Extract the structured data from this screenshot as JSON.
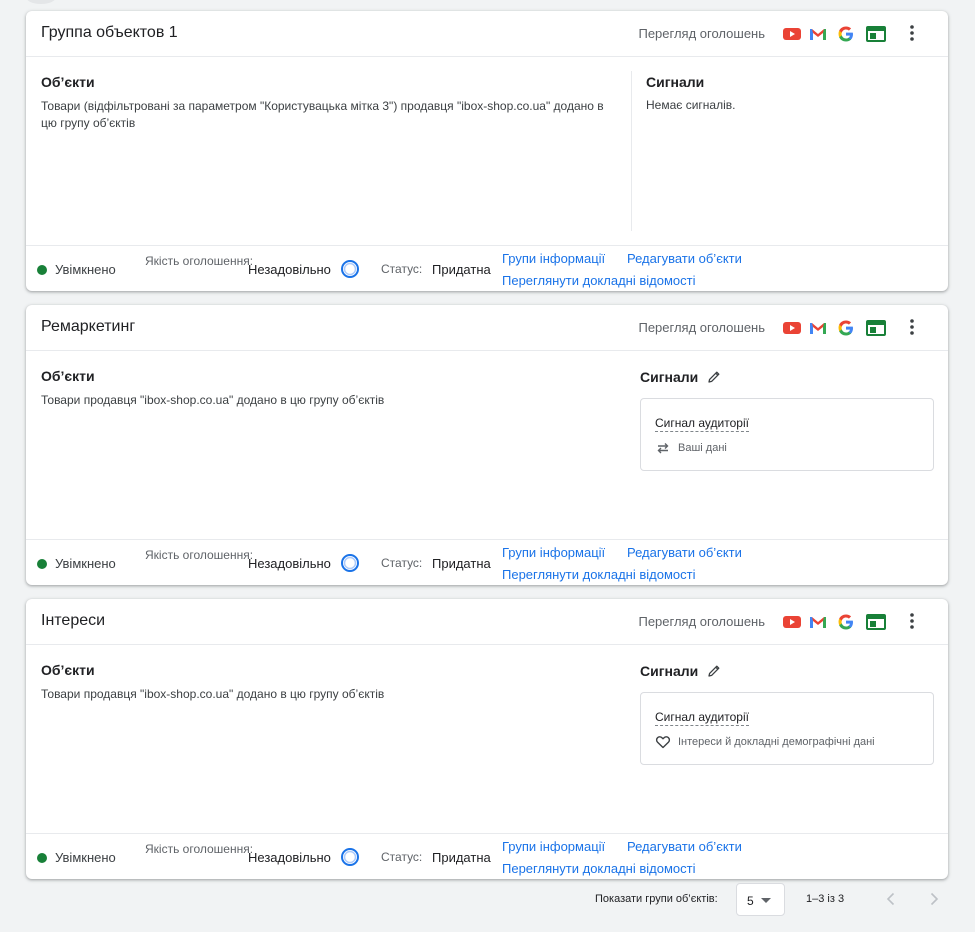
{
  "cards": [
    {
      "title": "Группа объектов 1",
      "preview_label": "Перегляд оголошень",
      "objects_title": "Об’єкти",
      "objects_desc": "Товари (відфільтровані за параметром \"Користувацька мітка 3\") продавця \"ibox-shop.co.ua\" додано в цю групу об’єктів",
      "signals_title": "Сигнали",
      "signals_empty": "Немає сигналів.",
      "status_on": "Увімкнено",
      "quality_label": "Якість оголошення:",
      "quality_value": "Незадовільно",
      "status_label": "Статус:",
      "status_value": "Придатна",
      "link_insights": "Групи інформації",
      "link_edit": "Редагувати об’єкти",
      "link_details": "Переглянути докладні відомості"
    },
    {
      "title": "Ремаркетинг",
      "preview_label": "Перегляд оголошень",
      "objects_title": "Об’єкти",
      "objects_desc": "Товари продавця \"ibox-shop.co.ua\" додано в цю групу об’єктів",
      "signals_title": "Сигнали",
      "signal_box_title": "Сигнал аудиторії",
      "signal_box_item": "Ваші дані",
      "signal_box_icon": "sync-arrows-icon",
      "status_on": "Увімкнено",
      "quality_label": "Якість оголошення:",
      "quality_value": "Незадовільно",
      "status_label": "Статус:",
      "status_value": "Придатна",
      "link_insights": "Групи інформації",
      "link_edit": "Редагувати об’єкти",
      "link_details": "Переглянути докладні відомості"
    },
    {
      "title": "Інтереси",
      "preview_label": "Перегляд оголошень",
      "objects_title": "Об’єкти",
      "objects_desc": "Товари продавця \"ibox-shop.co.ua\" додано в цю групу об’єктів",
      "signals_title": "Сигнали",
      "signal_box_title": "Сигнал аудиторії",
      "signal_box_item": "Інтереси й докладні демографічні дані",
      "signal_box_icon": "heart-icon",
      "status_on": "Увімкнено",
      "quality_label": "Якість оголошення:",
      "quality_value": "Незадовільно",
      "status_label": "Статус:",
      "status_value": "Придатна",
      "link_insights": "Групи інформації",
      "link_edit": "Редагувати об’єкти",
      "link_details": "Переглянути докладні відомості"
    }
  ],
  "pagination": {
    "label": "Показати групи об’єктів:",
    "page_size": "5",
    "range": "1–3 із 3"
  },
  "colors": {
    "accent": "#1a73e8",
    "status_green": "#188038",
    "youtube_red": "#ea4335",
    "display_green": "#188038"
  }
}
